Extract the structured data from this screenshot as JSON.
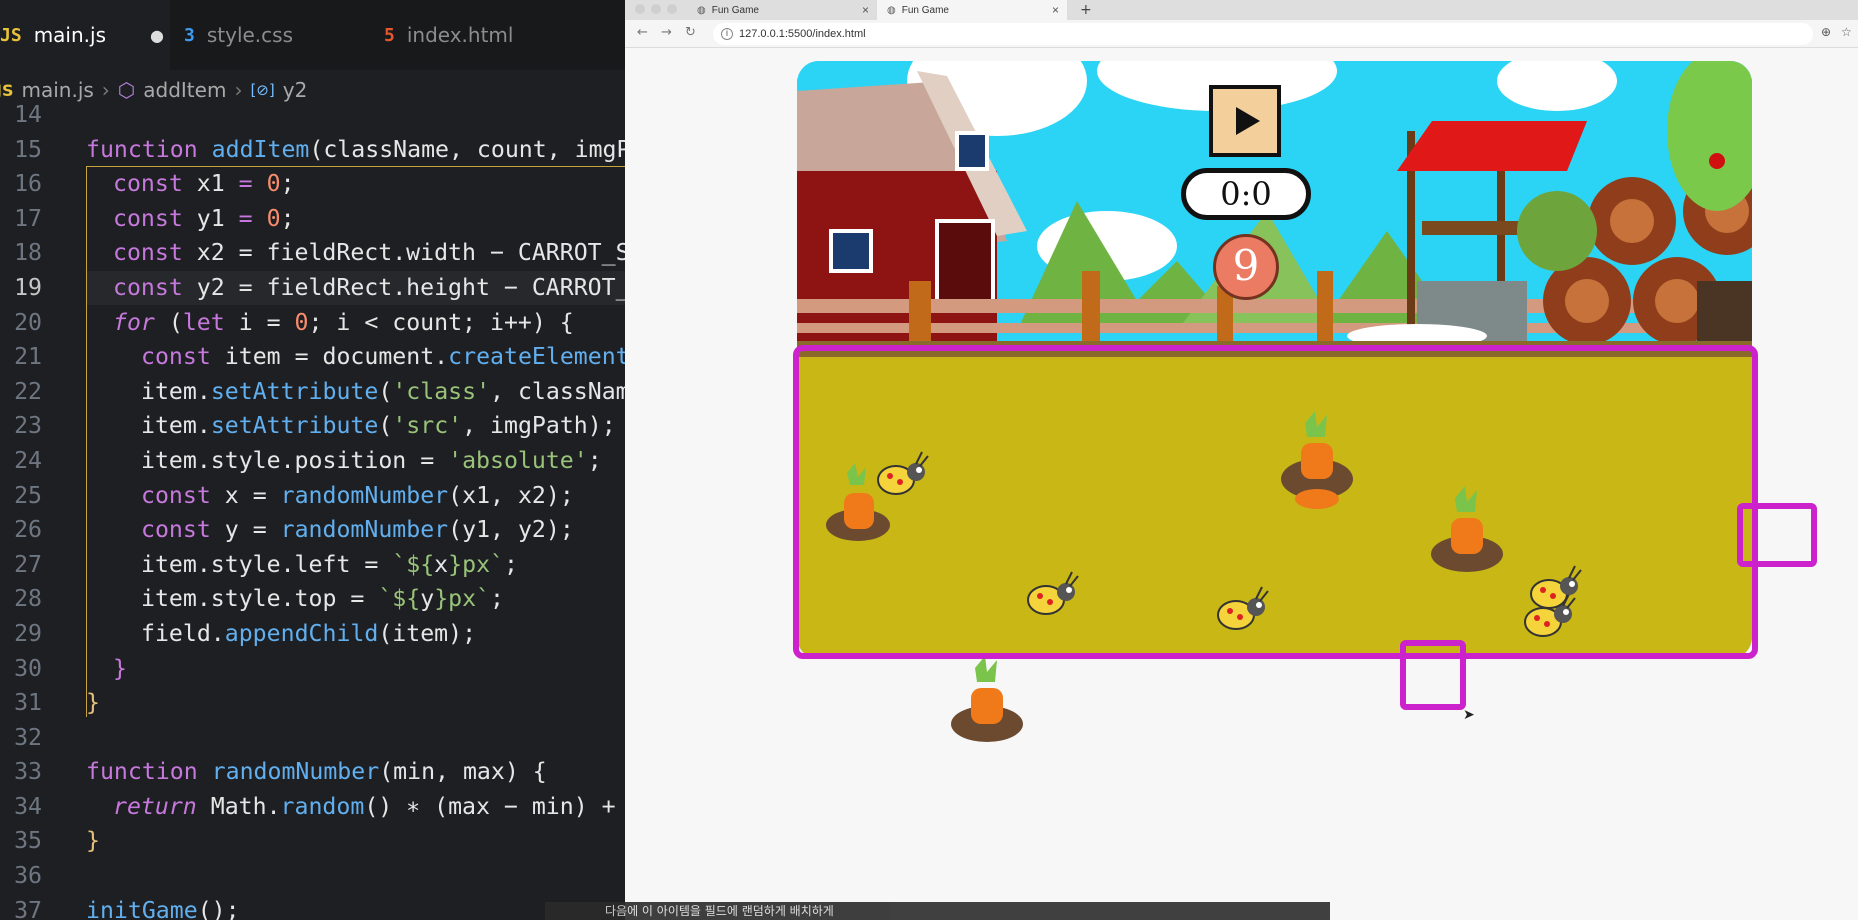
{
  "editor": {
    "tabs": [
      {
        "icon": "JS",
        "label": "main.js",
        "modified": "●"
      },
      {
        "icon": "3",
        "label": "style.css"
      },
      {
        "icon": "5",
        "label": "index.html"
      }
    ],
    "breadcrumb": {
      "file": "main.js",
      "function": "addItem",
      "variable": "y2",
      "file_icon": "JS"
    },
    "line_numbers": [
      "14",
      "15",
      "16",
      "17",
      "18",
      "19",
      "20",
      "21",
      "22",
      "23",
      "24",
      "25",
      "26",
      "27",
      "28",
      "29",
      "30",
      "31",
      "32",
      "33",
      "34",
      "35",
      "36",
      "37"
    ]
  },
  "code": {
    "l15": [
      "function",
      "addItem",
      "(className, count, imgP"
    ],
    "l16": [
      "const",
      "x1",
      "=",
      "0",
      ";"
    ],
    "l17": [
      "const",
      "y1",
      "=",
      "0",
      ";"
    ],
    "l18": [
      "const",
      "x2 = fieldRect.width − CARROT_S"
    ],
    "l19": [
      "const",
      "y2 = fieldRect.height − CARROT_"
    ],
    "l20": [
      "for",
      "(",
      "let",
      "i = ",
      "0",
      "; i < count; i++) {"
    ],
    "l21": [
      "const",
      "item = document.",
      "createElement"
    ],
    "l22": [
      "item.",
      "setAttribute",
      "(",
      "'class'",
      ", classNam"
    ],
    "l23": [
      "item.",
      "setAttribute",
      "(",
      "'src'",
      ", imgPath);"
    ],
    "l24": [
      "item.style.position = ",
      "'absolute'",
      ";"
    ],
    "l25": [
      "const",
      "x = ",
      "randomNumber",
      "(x1, x2);"
    ],
    "l26": [
      "const",
      "y = ",
      "randomNumber",
      "(y1, y2);"
    ],
    "l27": [
      "item.style.left = ",
      "`${",
      "x",
      "}",
      "px",
      "`",
      ";"
    ],
    "l28": [
      "item.style.top = ",
      "`${",
      "y",
      "}",
      "px",
      "`",
      ";"
    ],
    "l29": [
      "field.",
      "appendChild",
      "(item);"
    ],
    "l30": [
      "}"
    ],
    "l31": [
      "}"
    ],
    "l33": [
      "function",
      "randomNumber",
      "(min, max) {"
    ],
    "l34": [
      "return",
      "Math.",
      "random",
      "() ∗ (max − min) +"
    ],
    "l35": [
      "}"
    ],
    "l37": [
      "initGame",
      "();"
    ]
  },
  "browser": {
    "tabs": [
      {
        "label": "Fun Game",
        "close": "×"
      },
      {
        "label": "Fun Game",
        "close": "×"
      }
    ],
    "new_tab": "+",
    "url": "127.0.0.1:5500/index.html",
    "nav": {
      "back": "←",
      "forward": "→",
      "reload": "↻"
    },
    "zoom_icon": "⊕",
    "star_icon": "☆"
  },
  "game": {
    "timer": "0:0",
    "score": "9",
    "carrots": 5,
    "bugs": 6
  },
  "colors": {
    "highlight": "#cc22cc",
    "field": "#c9b716",
    "sky": "#2bd4f4",
    "score_bg": "#ec7b64"
  },
  "subtitle": "다음에 이 아이템을 필드에 랜덤하게 배치하게"
}
